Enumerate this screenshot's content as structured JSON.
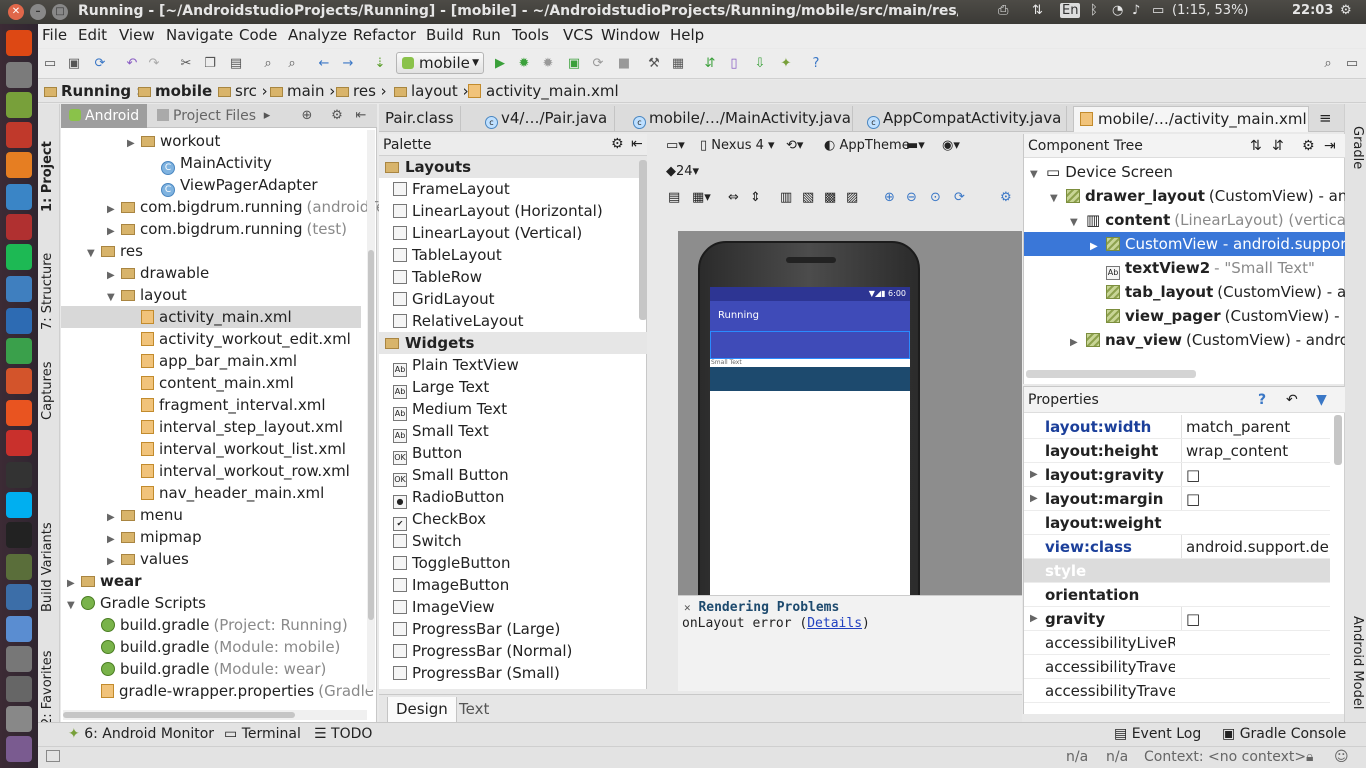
{
  "window": {
    "title": "Running - [~/AndroidstudioProjects/Running] - [mobile] - ~/AndroidstudioProjects/Running/mobile/src/main/res/layout/ac",
    "indicators": {
      "keyboard": "En",
      "battery": "(1:15, 53%)",
      "clock": "22:03"
    }
  },
  "menu": [
    "File",
    "Edit",
    "View",
    "Navigate",
    "Code",
    "Analyze",
    "Refactor",
    "Build",
    "Run",
    "Tools",
    "VCS",
    "Window",
    "Help"
  ],
  "toolbar": {
    "run_config": "mobile"
  },
  "breadcrumb": [
    "Running",
    "mobile",
    "src",
    "main",
    "res",
    "layout",
    "activity_main.xml"
  ],
  "left_tabs": [
    "1: Project",
    "7: Structure",
    "Captures",
    "Build Variants",
    "2: Favorites"
  ],
  "right_tabs": [
    "Gradle",
    "Android Model"
  ],
  "project": {
    "tabs": [
      "Android",
      "Project Files"
    ],
    "rows": [
      {
        "label": "workout",
        "icon": "folder",
        "indent": 4,
        "arrow": "▶"
      },
      {
        "label": "MainActivity",
        "icon": "class",
        "indent": 5,
        "arrow": ""
      },
      {
        "label": "ViewPagerAdapter",
        "icon": "class",
        "indent": 5,
        "arrow": ""
      },
      {
        "label": "com.bigdrum.running",
        "suffix": "(androidTe",
        "icon": "folder",
        "indent": 3,
        "arrow": "▶"
      },
      {
        "label": "com.bigdrum.running",
        "suffix": "(test)",
        "icon": "folder",
        "indent": 3,
        "arrow": "▶"
      },
      {
        "label": "res",
        "icon": "folder",
        "indent": 2,
        "arrow": "▼"
      },
      {
        "label": "drawable",
        "icon": "folder",
        "indent": 3,
        "arrow": "▶"
      },
      {
        "label": "layout",
        "icon": "folder",
        "indent": 3,
        "arrow": "▼"
      },
      {
        "label": "activity_main.xml",
        "icon": "xml",
        "indent": 4,
        "arrow": "",
        "selected": true
      },
      {
        "label": "activity_workout_edit.xml",
        "icon": "xml",
        "indent": 4,
        "arrow": ""
      },
      {
        "label": "app_bar_main.xml",
        "icon": "xml",
        "indent": 4,
        "arrow": ""
      },
      {
        "label": "content_main.xml",
        "icon": "xml",
        "indent": 4,
        "arrow": ""
      },
      {
        "label": "fragment_interval.xml",
        "icon": "xml",
        "indent": 4,
        "arrow": ""
      },
      {
        "label": "interval_step_layout.xml",
        "icon": "xml",
        "indent": 4,
        "arrow": ""
      },
      {
        "label": "interval_workout_list.xml",
        "icon": "xml",
        "indent": 4,
        "arrow": ""
      },
      {
        "label": "interval_workout_row.xml",
        "icon": "xml",
        "indent": 4,
        "arrow": ""
      },
      {
        "label": "nav_header_main.xml",
        "icon": "xml",
        "indent": 4,
        "arrow": ""
      },
      {
        "label": "menu",
        "icon": "folder",
        "indent": 3,
        "arrow": "▶"
      },
      {
        "label": "mipmap",
        "icon": "folder",
        "indent": 3,
        "arrow": "▶"
      },
      {
        "label": "values",
        "icon": "folder",
        "indent": 3,
        "arrow": "▶"
      },
      {
        "label": "wear",
        "icon": "folder",
        "indent": 1,
        "arrow": "▶",
        "bold": true
      },
      {
        "label": "Gradle Scripts",
        "icon": "gradle",
        "indent": 1,
        "arrow": "▼"
      },
      {
        "label": "build.gradle",
        "suffix": "(Project: Running)",
        "icon": "gradle",
        "indent": 2,
        "arrow": ""
      },
      {
        "label": "build.gradle",
        "suffix": "(Module: mobile)",
        "icon": "gradle",
        "indent": 2,
        "arrow": ""
      },
      {
        "label": "build.gradle",
        "suffix": "(Module: wear)",
        "icon": "gradle",
        "indent": 2,
        "arrow": ""
      },
      {
        "label": "gradle-wrapper.properties",
        "suffix": "(Gradle",
        "icon": "xml",
        "indent": 2,
        "arrow": ""
      }
    ]
  },
  "editor_tabs": [
    {
      "label": "Pair.class"
    },
    {
      "label": "v4/…/Pair.java"
    },
    {
      "label": "mobile/…/MainActivity.java"
    },
    {
      "label": "AppCompatActivity.java"
    },
    {
      "label": "mobile/…/activity_main.xml",
      "active": true
    }
  ],
  "palette": {
    "title": "Palette",
    "rows": [
      {
        "label": "Layouts",
        "group": true
      },
      {
        "label": "FrameLayout"
      },
      {
        "label": "LinearLayout (Horizontal)"
      },
      {
        "label": "LinearLayout (Vertical)"
      },
      {
        "label": "TableLayout"
      },
      {
        "label": "TableRow"
      },
      {
        "label": "GridLayout"
      },
      {
        "label": "RelativeLayout"
      },
      {
        "label": "Widgets",
        "group": true
      },
      {
        "label": "Plain TextView",
        "icon": "Ab"
      },
      {
        "label": "Large Text",
        "icon": "Ab"
      },
      {
        "label": "Medium Text",
        "icon": "Ab"
      },
      {
        "label": "Small Text",
        "icon": "Ab"
      },
      {
        "label": "Button",
        "icon": "OK"
      },
      {
        "label": "Small Button",
        "icon": "OK"
      },
      {
        "label": "RadioButton",
        "icon": "●"
      },
      {
        "label": "CheckBox",
        "icon": "✔"
      },
      {
        "label": "Switch"
      },
      {
        "label": "ToggleButton"
      },
      {
        "label": "ImageButton"
      },
      {
        "label": "ImageView"
      },
      {
        "label": "ProgressBar (Large)"
      },
      {
        "label": "ProgressBar (Normal)"
      },
      {
        "label": "ProgressBar (Small)"
      }
    ]
  },
  "design_tabs": [
    "Design",
    "Text"
  ],
  "canvas_toolbar": {
    "device": "Nexus 4",
    "theme": "AppTheme",
    "api": "24"
  },
  "phone": {
    "status_time": "6:00",
    "app_title": "Running",
    "small_text": "Small Text"
  },
  "render_problems": {
    "title": "Rendering Problems",
    "message": "onLayout error (",
    "link": "Details",
    "suffix": ")"
  },
  "component_tree": {
    "title": "Component Tree",
    "rows": [
      {
        "label": "Device Screen",
        "indent": 0,
        "arrow": "▼"
      },
      {
        "label": "drawer_layout",
        "suffix": "(CustomView) - androi",
        "indent": 1,
        "arrow": "▼",
        "bold": true
      },
      {
        "label": "content",
        "suffix": "(LinearLayout) (vertical)",
        "indent": 2,
        "arrow": "▼",
        "bold": true
      },
      {
        "label": "CustomView - android.support.c",
        "indent": 3,
        "arrow": "▶",
        "selected": true
      },
      {
        "label": "textView2",
        "suffix": "- \"Small Text\"",
        "indent": 3,
        "arrow": "",
        "bold": true
      },
      {
        "label": "tab_layout",
        "suffix": "(CustomView) - andr",
        "indent": 3,
        "arrow": "",
        "bold": true
      },
      {
        "label": "view_pager",
        "suffix": "(CustomView) - anc",
        "indent": 3,
        "arrow": "",
        "bold": true
      },
      {
        "label": "nav_view",
        "suffix": "(CustomView) - android.s",
        "indent": 2,
        "arrow": "▶",
        "bold": true
      }
    ]
  },
  "properties": {
    "title": "Properties",
    "rows": [
      {
        "key": "layout:width",
        "value": "match_parent",
        "blue": true
      },
      {
        "key": "layout:height",
        "value": "wrap_content"
      },
      {
        "key": "layout:gravity",
        "value": "□",
        "arrow": true
      },
      {
        "key": "layout:margin",
        "value": "□",
        "arrow": true
      },
      {
        "key": "layout:weight",
        "value": ""
      },
      {
        "key": "view:class",
        "value": "android.support.de...",
        "blue": true
      },
      {
        "key": "style",
        "value": "",
        "shaded": true
      },
      {
        "key": "orientation",
        "value": ""
      },
      {
        "key": "gravity",
        "value": "□",
        "arrow": true
      },
      {
        "key": "accessibilityLiveReg",
        "value": ""
      },
      {
        "key": "accessibilityTravers",
        "value": ""
      },
      {
        "key": "accessibilityTravers",
        "value": ""
      }
    ]
  },
  "bottom_tools": [
    "6: Android Monitor",
    "Terminal",
    "TODO",
    "Event Log",
    "Gradle Console"
  ],
  "status": {
    "pos1": "n/a",
    "pos2": "n/a",
    "context": "Context: <no context>"
  }
}
